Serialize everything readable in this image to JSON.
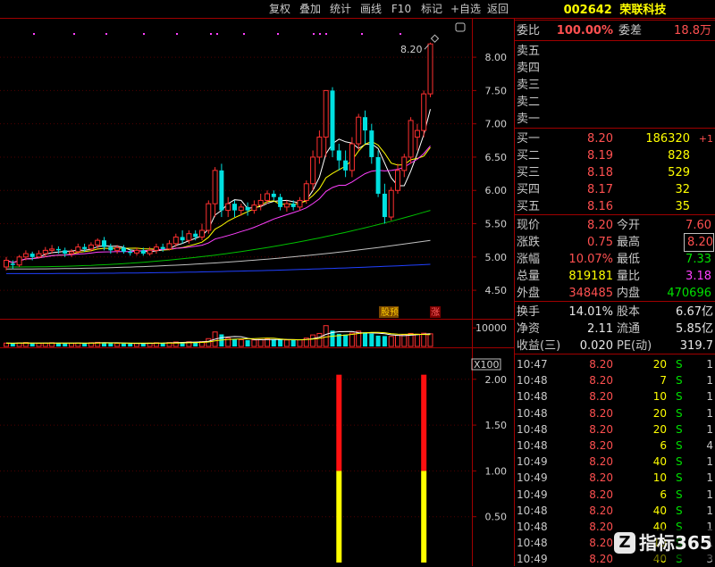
{
  "toolbar": {
    "buttons": [
      "复权",
      "叠加",
      "统计",
      "画线",
      "F10",
      "标记",
      "+自选",
      "返回"
    ]
  },
  "stock": {
    "code": "002642",
    "name": "荣联科技"
  },
  "colors": {
    "up": "#ff3030",
    "down": "#00e0e0",
    "ma5": "#ffffff",
    "ma10": "#ffff00",
    "ma20": "#ff40ff",
    "ma60": "#00c000",
    "ma120": "#c0c0c0",
    "ma250": "#2040ff",
    "bg": "#000000",
    "grid": "#a00000"
  },
  "main_chart": {
    "y_ticks": [
      "8.00",
      "7.50",
      "7.00",
      "6.50",
      "6.00",
      "5.50",
      "5.00",
      "4.50"
    ],
    "price_label": "8.20",
    "markers": [
      "股预",
      "涨"
    ]
  },
  "volume_chart": {
    "y_tick": "10000",
    "unit": "X100"
  },
  "indicator_chart": {
    "y_ticks": [
      "2.00",
      "1.50",
      "1.00",
      "0.50"
    ]
  },
  "chart_data": [
    {
      "type": "candlestick",
      "ylim": [
        4.3,
        8.35
      ],
      "y_ticks": [
        4.5,
        5.0,
        5.5,
        6.0,
        6.5,
        7.0,
        7.5,
        8.0
      ],
      "last_price": 8.2,
      "candles": [
        [
          4.85,
          4.95,
          4.8,
          5.0
        ],
        [
          4.9,
          4.88,
          4.82,
          4.95
        ],
        [
          4.88,
          5.0,
          4.85,
          5.03
        ],
        [
          5.0,
          5.05,
          4.95,
          5.1
        ],
        [
          5.05,
          5.0,
          4.95,
          5.08
        ],
        [
          5.0,
          5.05,
          4.98,
          5.1
        ],
        [
          5.05,
          5.1,
          5.0,
          5.15
        ],
        [
          5.1,
          5.12,
          5.05,
          5.18
        ],
        [
          5.12,
          5.1,
          5.05,
          5.16
        ],
        [
          5.1,
          5.05,
          5.0,
          5.14
        ],
        [
          5.05,
          5.08,
          5.0,
          5.12
        ],
        [
          5.08,
          5.15,
          5.05,
          5.2
        ],
        [
          5.15,
          5.12,
          5.08,
          5.2
        ],
        [
          5.12,
          5.18,
          5.08,
          5.22
        ],
        [
          5.18,
          5.25,
          5.12,
          5.28
        ],
        [
          5.25,
          5.15,
          5.1,
          5.3
        ],
        [
          5.15,
          5.1,
          5.05,
          5.2
        ],
        [
          5.1,
          5.14,
          5.05,
          5.18
        ],
        [
          5.14,
          5.08,
          5.05,
          5.18
        ],
        [
          5.08,
          5.06,
          5.02,
          5.12
        ],
        [
          5.06,
          5.1,
          5.02,
          5.14
        ],
        [
          5.1,
          5.05,
          5.02,
          5.14
        ],
        [
          5.05,
          5.1,
          5.02,
          5.15
        ],
        [
          5.1,
          5.15,
          5.05,
          5.2
        ],
        [
          5.15,
          5.12,
          5.08,
          5.2
        ],
        [
          5.12,
          5.2,
          5.1,
          5.25
        ],
        [
          5.2,
          5.3,
          5.15,
          5.35
        ],
        [
          5.3,
          5.25,
          5.2,
          5.4
        ],
        [
          5.25,
          5.35,
          5.2,
          5.4
        ],
        [
          5.35,
          5.3,
          5.25,
          5.4
        ],
        [
          5.3,
          5.4,
          5.25,
          5.5
        ],
        [
          5.4,
          5.8,
          5.35,
          5.85
        ],
        [
          5.8,
          6.3,
          5.6,
          6.35
        ],
        [
          6.3,
          5.7,
          5.6,
          6.4
        ],
        [
          5.7,
          5.8,
          5.6,
          5.9
        ],
        [
          5.8,
          5.7,
          5.6,
          5.85
        ],
        [
          5.7,
          5.75,
          5.62,
          5.8
        ],
        [
          5.75,
          5.7,
          5.62,
          5.82
        ],
        [
          5.7,
          5.78,
          5.65,
          5.85
        ],
        [
          5.78,
          5.85,
          5.7,
          5.95
        ],
        [
          5.85,
          5.95,
          5.8,
          6.0
        ],
        [
          5.95,
          5.9,
          5.85,
          6.0
        ],
        [
          5.9,
          5.75,
          5.7,
          5.95
        ],
        [
          5.75,
          5.8,
          5.68,
          5.85
        ],
        [
          5.8,
          5.75,
          5.7,
          5.85
        ],
        [
          5.75,
          5.85,
          5.7,
          5.9
        ],
        [
          5.85,
          6.1,
          5.8,
          6.15
        ],
        [
          6.1,
          6.5,
          6.0,
          6.6
        ],
        [
          6.5,
          6.8,
          6.4,
          6.9
        ],
        [
          6.8,
          7.5,
          6.5,
          7.5
        ],
        [
          7.5,
          6.6,
          6.5,
          7.55
        ],
        [
          6.6,
          6.45,
          6.3,
          6.7
        ],
        [
          6.45,
          6.3,
          6.2,
          6.6
        ],
        [
          6.3,
          6.7,
          6.2,
          6.8
        ],
        [
          6.7,
          7.1,
          6.6,
          7.15
        ],
        [
          7.1,
          6.9,
          6.7,
          7.2
        ],
        [
          6.9,
          6.5,
          6.4,
          7.0
        ],
        [
          6.5,
          5.95,
          5.9,
          6.6
        ],
        [
          5.95,
          5.6,
          5.5,
          6.1
        ],
        [
          5.6,
          6.0,
          5.55,
          6.05
        ],
        [
          6.0,
          6.3,
          5.95,
          6.4
        ],
        [
          6.3,
          6.5,
          6.2,
          6.55
        ],
        [
          6.5,
          7.05,
          6.4,
          7.1
        ],
        [
          6.8,
          6.9,
          6.6,
          7.0
        ],
        [
          6.9,
          7.45,
          6.8,
          7.5
        ],
        [
          7.45,
          8.2,
          7.4,
          8.22
        ]
      ]
    },
    {
      "type": "bar",
      "name": "volume",
      "y_tick": 10000,
      "values": [
        1800,
        1700,
        1900,
        2100,
        1600,
        1700,
        1800,
        2000,
        1700,
        1600,
        1700,
        1900,
        1800,
        2000,
        2200,
        2100,
        1800,
        1700,
        1600,
        1500,
        1600,
        1700,
        1800,
        2000,
        1900,
        2100,
        2400,
        2300,
        2500,
        2400,
        2600,
        4200,
        7800,
        6500,
        4500,
        3800,
        3600,
        3400,
        3500,
        3700,
        4000,
        3800,
        3600,
        3500,
        3400,
        3600,
        4500,
        6200,
        7000,
        11200,
        8500,
        6800,
        6400,
        7200,
        8200,
        7600,
        6900,
        5800,
        5600,
        5400,
        6000,
        6400,
        7000,
        6600,
        7100,
        6800
      ]
    },
    {
      "type": "bar",
      "name": "signal",
      "ylim": [
        0,
        2.3
      ],
      "y_ticks": [
        0.5,
        1.0,
        1.5,
        2.0
      ],
      "signals": [
        {
          "index": 51,
          "value": 2.0
        },
        {
          "index": 64,
          "value": 2.0
        }
      ]
    }
  ],
  "panel": {
    "weibi_label": "委比",
    "weibi_value": "100.00%",
    "weicha_label": "委差",
    "weicha_value": "18.8万",
    "asks": [
      {
        "label": "卖五",
        "price": "",
        "vol": ""
      },
      {
        "label": "卖四",
        "price": "",
        "vol": ""
      },
      {
        "label": "卖三",
        "price": "",
        "vol": ""
      },
      {
        "label": "卖二",
        "price": "",
        "vol": ""
      },
      {
        "label": "卖一",
        "price": "",
        "vol": ""
      }
    ],
    "bids": [
      {
        "label": "买一",
        "price": "8.20",
        "vol": "186320",
        "chg": "+1"
      },
      {
        "label": "买二",
        "price": "8.19",
        "vol": "828",
        "chg": ""
      },
      {
        "label": "买三",
        "price": "8.18",
        "vol": "529",
        "chg": ""
      },
      {
        "label": "买四",
        "price": "8.17",
        "vol": "32",
        "chg": ""
      },
      {
        "label": "买五",
        "price": "8.16",
        "vol": "35",
        "chg": ""
      }
    ],
    "quote": [
      {
        "l1": "现价",
        "v1": "8.20",
        "c1": "red",
        "l2": "今开",
        "v2": "7.60",
        "c2": "red"
      },
      {
        "l1": "涨跌",
        "v1": "0.75",
        "c1": "red",
        "l2": "最高",
        "v2": "8.20",
        "c2": "red"
      },
      {
        "l1": "涨幅",
        "v1": "10.07%",
        "c1": "red",
        "l2": "最低",
        "v2": "7.33",
        "c2": "green"
      },
      {
        "l1": "总量",
        "v1": "819181",
        "c1": "yellow",
        "l2": "量比",
        "v2": "3.18",
        "c2": "magenta"
      },
      {
        "l1": "外盘",
        "v1": "348485",
        "c1": "red",
        "l2": "内盘",
        "v2": "470696",
        "c2": "green"
      }
    ],
    "info": [
      {
        "l1": "换手",
        "v1": "14.01%",
        "l2": "股本",
        "v2": "6.67亿"
      },
      {
        "l1": "净资",
        "v1": "2.11",
        "l2": "流通",
        "v2": "5.85亿"
      },
      {
        "l1": "收益(三)",
        "v1": "0.020",
        "l2": "PE(动)",
        "v2": "319.7"
      }
    ],
    "ticks": [
      {
        "time": "10:47",
        "price": "8.20",
        "vol": "20",
        "side": "S",
        "n": "1"
      },
      {
        "time": "10:48",
        "price": "8.20",
        "vol": "7",
        "side": "S",
        "n": "1"
      },
      {
        "time": "10:48",
        "price": "8.20",
        "vol": "10",
        "side": "S",
        "n": "1"
      },
      {
        "time": "10:48",
        "price": "8.20",
        "vol": "20",
        "side": "S",
        "n": "1"
      },
      {
        "time": "10:48",
        "price": "8.20",
        "vol": "20",
        "side": "S",
        "n": "1"
      },
      {
        "time": "10:48",
        "price": "8.20",
        "vol": "6",
        "side": "S",
        "n": "4"
      },
      {
        "time": "10:49",
        "price": "8.20",
        "vol": "40",
        "side": "S",
        "n": "1"
      },
      {
        "time": "10:49",
        "price": "8.20",
        "vol": "10",
        "side": "S",
        "n": "1"
      },
      {
        "time": "10:49",
        "price": "8.20",
        "vol": "6",
        "side": "S",
        "n": "1"
      },
      {
        "time": "10:48",
        "price": "8.20",
        "vol": "40",
        "side": "S",
        "n": "1"
      },
      {
        "time": "10:48",
        "price": "8.20",
        "vol": "40",
        "side": "S",
        "n": "1"
      },
      {
        "time": "10:48",
        "price": "8.20",
        "vol": "10",
        "side": "S",
        "n": "1"
      },
      {
        "time": "10:49",
        "price": "8.20",
        "vol": "40",
        "side": "S",
        "n": "3"
      }
    ]
  },
  "watermark": "指标365"
}
